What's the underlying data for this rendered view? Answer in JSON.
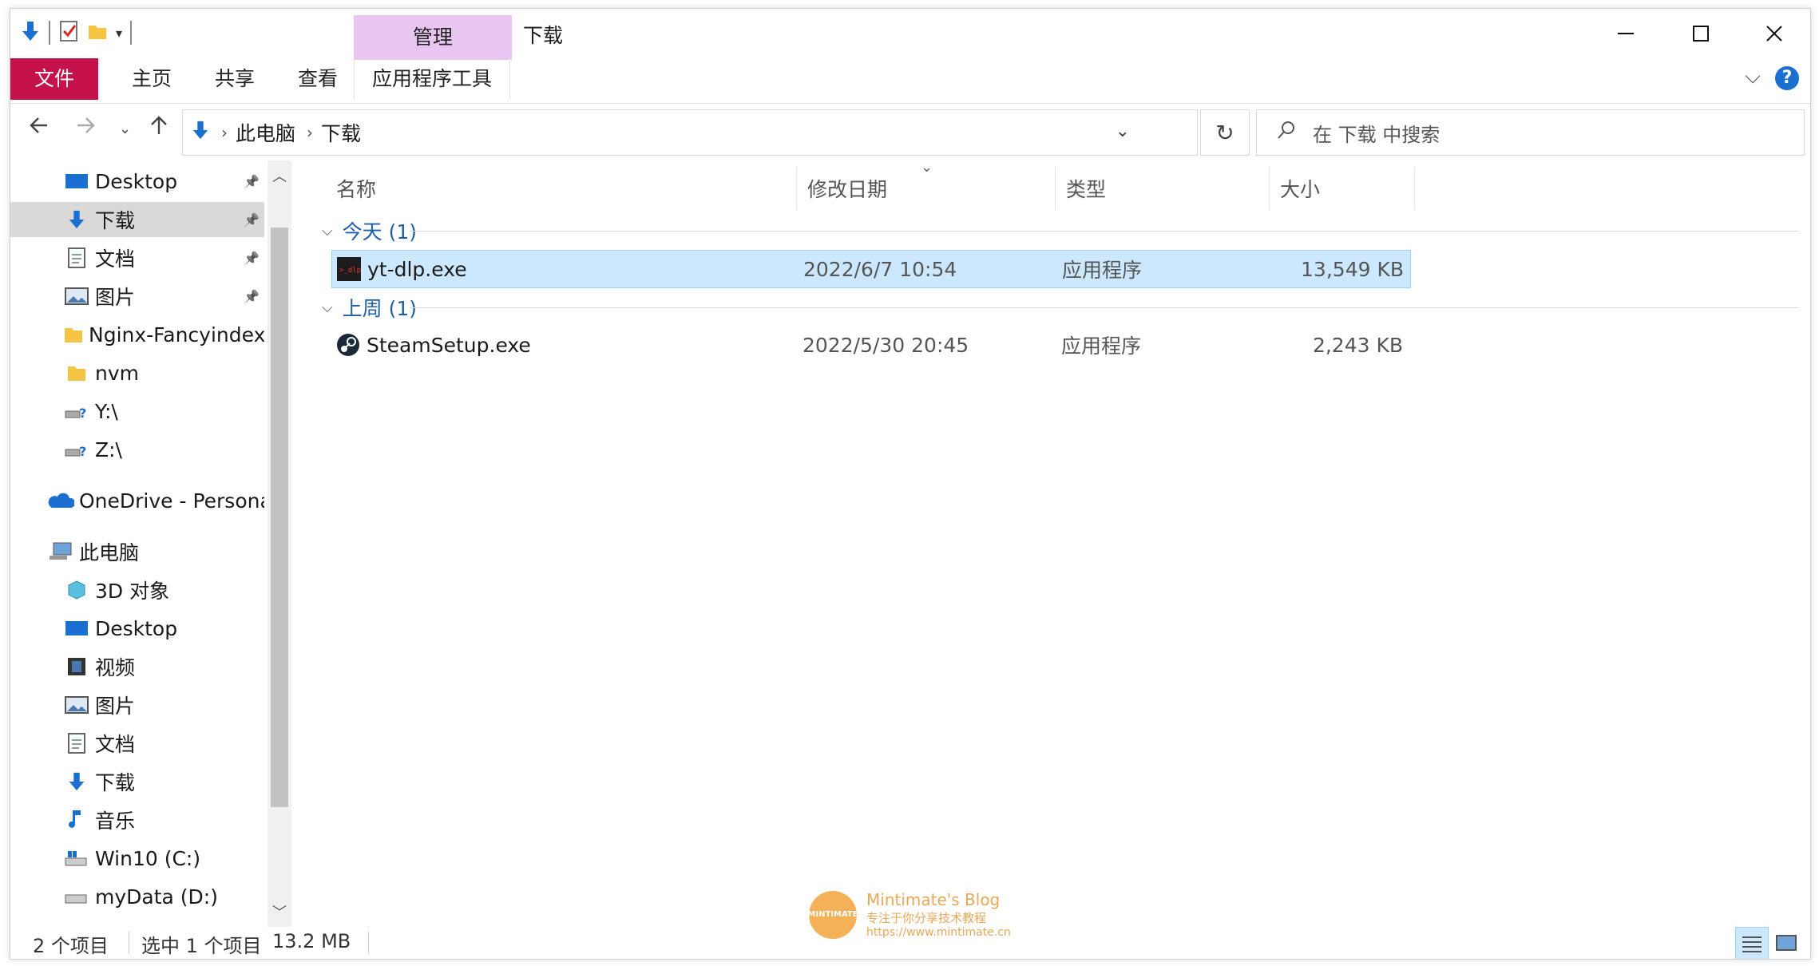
{
  "window": {
    "title": "下载"
  },
  "ribbon": {
    "contextual_group": "管理",
    "tabs": [
      "文件",
      "主页",
      "共享",
      "查看",
      "应用程序工具"
    ]
  },
  "address": {
    "crumbs": [
      "此电脑",
      "下载"
    ],
    "search_placeholder": "在 下载 中搜索"
  },
  "nav": {
    "items": [
      {
        "label": "Desktop",
        "icon": "desktop-icon",
        "pinned": true
      },
      {
        "label": "下载",
        "icon": "download-icon",
        "pinned": true,
        "selected": true
      },
      {
        "label": "文档",
        "icon": "document-icon",
        "pinned": true
      },
      {
        "label": "图片",
        "icon": "picture-icon",
        "pinned": true
      },
      {
        "label": "Nginx-Fancyindex-",
        "icon": "folder-icon"
      },
      {
        "label": "nvm",
        "icon": "folder-icon"
      },
      {
        "label": "Y:\\",
        "icon": "network-drive-icon"
      },
      {
        "label": "Z:\\",
        "icon": "network-drive-icon"
      },
      {
        "label": "OneDrive - Personal",
        "icon": "onedrive-icon"
      },
      {
        "label": "此电脑",
        "icon": "computer-icon"
      },
      {
        "label": "3D 对象",
        "icon": "3d-objects-icon"
      },
      {
        "label": "Desktop",
        "icon": "desktop-icon"
      },
      {
        "label": "视频",
        "icon": "video-icon"
      },
      {
        "label": "图片",
        "icon": "picture-icon"
      },
      {
        "label": "文档",
        "icon": "document-icon"
      },
      {
        "label": "下载",
        "icon": "download-icon"
      },
      {
        "label": "音乐",
        "icon": "music-icon"
      },
      {
        "label": "Win10 (C:)",
        "icon": "windows-drive-icon"
      },
      {
        "label": "myData (D:)",
        "icon": "drive-icon"
      }
    ]
  },
  "columns": [
    "名称",
    "修改日期",
    "类型",
    "大小"
  ],
  "groups": [
    {
      "label": "今天 (1)",
      "files": [
        {
          "name": "yt-dlp.exe",
          "date": "2022/6/7 10:54",
          "type": "应用程序",
          "size": "13,549 KB",
          "selected": true
        }
      ]
    },
    {
      "label": "上周 (1)",
      "files": [
        {
          "name": "SteamSetup.exe",
          "date": "2022/5/30 20:45",
          "type": "应用程序",
          "size": "2,243 KB"
        }
      ]
    }
  ],
  "status": {
    "count": "2 个项目",
    "selection": "选中 1 个项目",
    "size": "13.2 MB"
  },
  "watermark": {
    "title": "Mintimate's Blog",
    "subtitle": "专注于你分享技术教程",
    "url": "https://www.mintimate.cn"
  },
  "colors": {
    "file_tab": "#c5124a",
    "manage_tab": "#e9c6f2",
    "selection": "#cce8ff",
    "link_blue": "#1f5fa8"
  }
}
